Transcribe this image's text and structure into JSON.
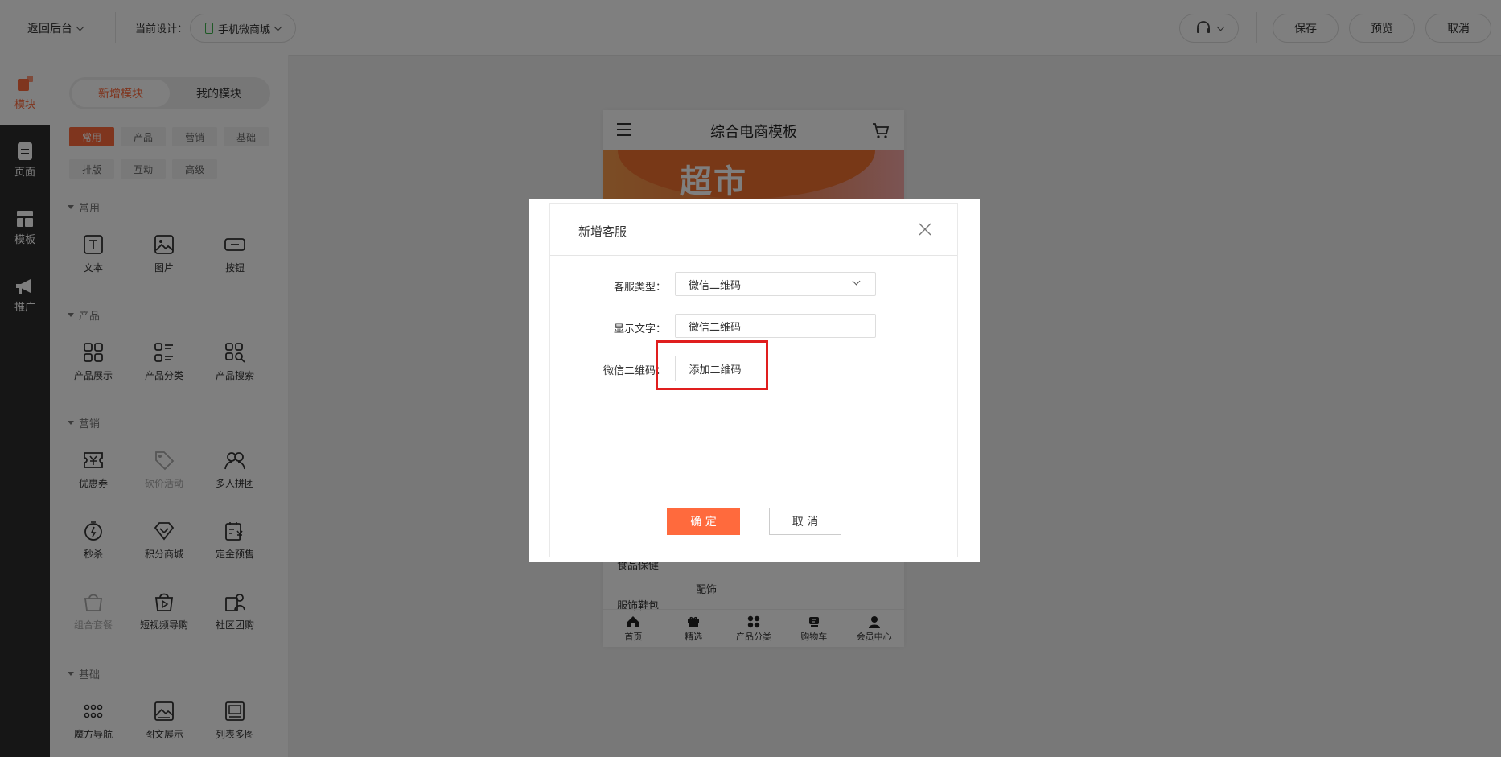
{
  "topbar": {
    "back": "返回后台",
    "current_design_label": "当前设计：",
    "current_design_value": "手机微商城",
    "save": "保存",
    "preview": "预览",
    "cancel": "取消"
  },
  "rail": {
    "items": [
      {
        "label": "模块",
        "icon": "module-icon"
      },
      {
        "label": "页面",
        "icon": "page-icon"
      },
      {
        "label": "模板",
        "icon": "template-icon"
      },
      {
        "label": "推广",
        "icon": "megaphone-icon"
      }
    ]
  },
  "panel": {
    "tabs": [
      "新增模块",
      "我的模块"
    ],
    "chips": [
      "常用",
      "产品",
      "营销",
      "基础",
      "排版",
      "互动",
      "高级"
    ],
    "sections": [
      {
        "title": "常用",
        "items": [
          "文本",
          "图片",
          "按钮"
        ]
      },
      {
        "title": "产品",
        "items": [
          "产品展示",
          "产品分类",
          "产品搜索"
        ]
      },
      {
        "title": "营销",
        "items": [
          "优惠券",
          "砍价活动",
          "多人拼团",
          "秒杀",
          "积分商城",
          "定金预售",
          "组合套餐",
          "短视频导购",
          "社区团购"
        ]
      },
      {
        "title": "基础",
        "items": [
          "魔方导航",
          "图文展示",
          "列表多图"
        ]
      }
    ]
  },
  "phone": {
    "title": "综合电商模板",
    "banner_text": "超市",
    "side_categories": [
      "食品保健",
      "服饰鞋包"
    ],
    "content_item": "配饰",
    "nav": [
      "首页",
      "精选",
      "产品分类",
      "购物车",
      "会员中心"
    ]
  },
  "dialog": {
    "title": "新增客服",
    "type_label": "客服类型：",
    "type_value": "微信二维码",
    "text_label": "显示文字：",
    "text_value": "微信二维码",
    "qr_label": "微信二维码：",
    "add_qr": "添加二维码",
    "confirm": "确 定",
    "cancel": "取 消"
  },
  "colors": {
    "accent": "#ff6a3d",
    "highlight_border": "#e01e1e"
  }
}
